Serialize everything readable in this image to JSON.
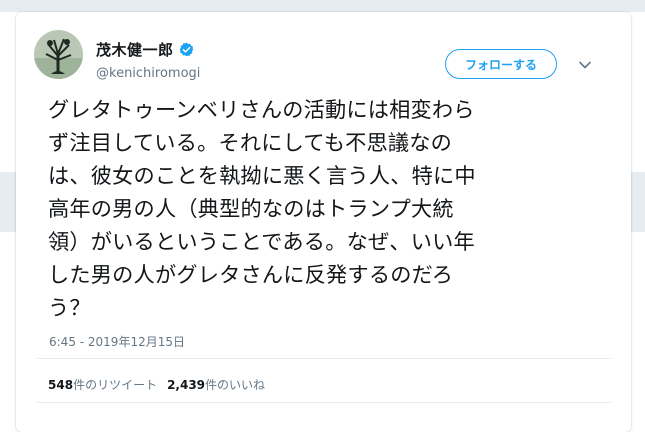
{
  "tweet": {
    "author": {
      "display_name": "茂木健一郎",
      "handle": "@kenichiromogi",
      "verified": true
    },
    "follow_label": "フォローする",
    "text": "グレタトゥーンベリさんの活動には相変わら\nず注目している。それにしても不思議なの\nは、彼女のことを執拗に悪く言う人、特に中\n高年の男の人（典型的なのはトランプ大統\n領）がいるということである。なぜ、いい年\nした男の人がグレタさんに反発するのだろ\nう？",
    "timestamp": "6:45 - 2019年12月15日",
    "stats": {
      "retweets_count": "548",
      "retweets_label": "件のリツイート",
      "likes_count": "2,439",
      "likes_label": "件のいいね"
    }
  },
  "colors": {
    "accent": "#1da1f2",
    "text": "#14171a",
    "secondary": "#657786",
    "background": "#e6ecf0"
  },
  "icons": {
    "verified": "verified-badge-icon",
    "caret": "chevron-down-icon",
    "avatar": "avatar-tree-illustration"
  }
}
